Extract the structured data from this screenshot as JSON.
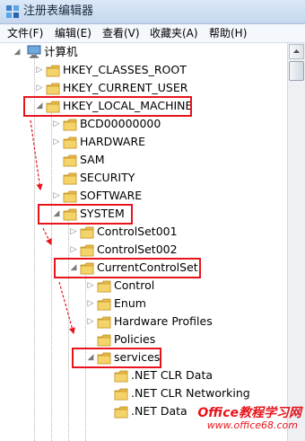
{
  "window": {
    "title": "注册表编辑器"
  },
  "menu": [
    "文件(F)",
    "编辑(E)",
    "查看(V)",
    "收藏夹(A)",
    "帮助(H)"
  ],
  "tree": {
    "root_label": "计算机",
    "nodes": [
      {
        "label": "HKEY_CLASSES_ROOT",
        "expander": "▷"
      },
      {
        "label": "HKEY_CURRENT_USER",
        "expander": "▷"
      },
      {
        "label": "HKEY_LOCAL_MACHINE",
        "expander": "◢"
      },
      {
        "label": "BCD00000000",
        "expander": "▷"
      },
      {
        "label": "HARDWARE",
        "expander": "▷"
      },
      {
        "label": "SAM",
        "expander": ""
      },
      {
        "label": "SECURITY",
        "expander": ""
      },
      {
        "label": "SOFTWARE",
        "expander": "▷"
      },
      {
        "label": "SYSTEM",
        "expander": "◢"
      },
      {
        "label": "ControlSet001",
        "expander": "▷"
      },
      {
        "label": "ControlSet002",
        "expander": "▷"
      },
      {
        "label": "CurrentControlSet",
        "expander": "◢"
      },
      {
        "label": "Control",
        "expander": "▷"
      },
      {
        "label": "Enum",
        "expander": "▷"
      },
      {
        "label": "Hardware Profiles",
        "expander": "▷"
      },
      {
        "label": "Policies",
        "expander": ""
      },
      {
        "label": "services",
        "expander": "◢"
      },
      {
        "label": ".NET CLR Data",
        "expander": ""
      },
      {
        "label": ".NET CLR Networking",
        "expander": ""
      },
      {
        "label": ".NET Data",
        "expander": ""
      }
    ]
  },
  "watermark": {
    "line1": "Office教程学习网",
    "line2": "www.office68.com"
  },
  "colors": {
    "highlight": "#e8141c",
    "folder": "#f2c94c"
  }
}
